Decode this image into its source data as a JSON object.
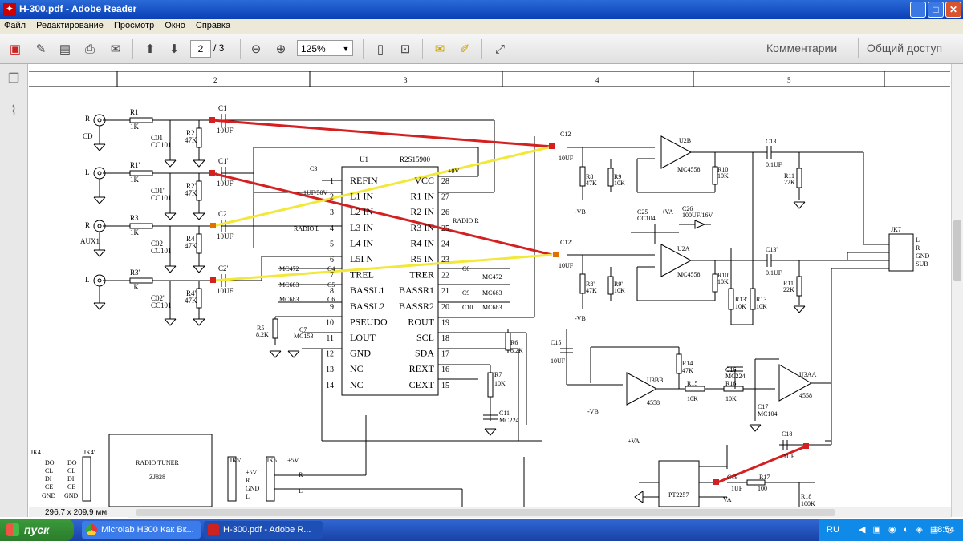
{
  "window": {
    "title": "H-300.pdf - Adobe Reader",
    "minimize": "_",
    "maximize": "□",
    "close": "✕"
  },
  "menu": [
    "Файл",
    "Редактирование",
    "Просмотр",
    "Окно",
    "Справка"
  ],
  "toolbar": {
    "page_current": "2",
    "page_total": "/ 3",
    "zoom": "125%",
    "comments": "Комментарии",
    "share": "Общий доступ"
  },
  "icons": [
    "create-pdf-icon",
    "edit-icon",
    "save-icon",
    "print-icon",
    "email-icon",
    "page-up-icon",
    "page-down-icon",
    "zoom-out-icon",
    "zoom-in-icon",
    "fit-page-icon",
    "fit-width-icon",
    "comment-icon",
    "highlight-icon",
    "fullscreen-icon",
    "pages-panel-icon",
    "attachments-icon"
  ],
  "status": {
    "page_size": "296,7 x 209,9 мм"
  },
  "schematic": {
    "columns": [
      "2",
      "3",
      "4",
      "5"
    ],
    "inputs": [
      {
        "jack": "R",
        "name": "CD",
        "r": "R1",
        "rv": "1K",
        "c": "C01",
        "cv": "CC101",
        "r2": "R2",
        "r2v": "47K",
        "cap": "C1",
        "capv": "10UF"
      },
      {
        "jack": "L",
        "name": "",
        "r": "R1'",
        "rv": "1K",
        "c": "C01'",
        "cv": "CC101",
        "r2": "R2'",
        "r2v": "47K",
        "cap": "C1'",
        "capv": "10UF"
      },
      {
        "jack": "R",
        "name": "AUX1",
        "r": "R3",
        "rv": "1K",
        "c": "C02",
        "cv": "CC101",
        "r2": "R4",
        "r2v": "47K",
        "cap": "C2",
        "capv": "10UF"
      },
      {
        "jack": "L",
        "name": "",
        "r": "R3'",
        "rv": "1K",
        "c": "C02'",
        "cv": "CC101",
        "r2": "R4'",
        "r2v": "47K",
        "cap": "C2'",
        "capv": "10UF"
      }
    ],
    "ic": {
      "ref": "U1",
      "part": "R2S15900",
      "left_pins": [
        [
          "REFIN",
          "1"
        ],
        [
          "L1 IN",
          "2"
        ],
        [
          "L2 IN",
          "3"
        ],
        [
          "L3 IN",
          "4"
        ],
        [
          "L4 IN",
          "5"
        ],
        [
          "L5I N",
          "6"
        ],
        [
          "TREL",
          "7"
        ],
        [
          "BASSL1",
          "8"
        ],
        [
          "BASSL2",
          "9"
        ],
        [
          "PSEUDO",
          "10"
        ],
        [
          "LOUT",
          "11"
        ],
        [
          "GND",
          "12"
        ],
        [
          "NC",
          "13"
        ],
        [
          "NC",
          "14"
        ]
      ],
      "right_pins": [
        [
          "VCC",
          "28"
        ],
        [
          "R1 IN",
          "27"
        ],
        [
          "R2 IN",
          "26"
        ],
        [
          "R3 IN",
          "25"
        ],
        [
          "R4 IN",
          "24"
        ],
        [
          "R5 IN",
          "23"
        ],
        [
          "TRER",
          "22"
        ],
        [
          "BASSR1",
          "21"
        ],
        [
          "BASSR2",
          "20"
        ],
        [
          "ROUT",
          "19"
        ],
        [
          "SCL",
          "18"
        ],
        [
          "SDA",
          "17"
        ],
        [
          "REXT",
          "16"
        ],
        [
          "CEXT",
          "15"
        ]
      ]
    },
    "labels": {
      "c3": "C3",
      "c3v": "1UF/50V",
      "vcc9": "+9V",
      "radio_l": "RADIO L",
      "radio_r": "RADIO R",
      "c4": "C4",
      "c4v": "MC472",
      "c5": "C5",
      "c5v": "MC683",
      "c6": "C6",
      "c6v": "MC683",
      "c7": "C7",
      "c7v": "MC153",
      "r5": "R5",
      "r5v": "8.2K",
      "c8": "C8",
      "c8v": "MC472",
      "c9": "C9",
      "c9v": "MC683",
      "c10": "C10",
      "c10v": "MC683",
      "r6": "R6",
      "r6v": "8.2K",
      "r7": "R7",
      "r7v": "10K",
      "c11": "C11",
      "c11v": "MC224",
      "c12": "C12",
      "c12v": "10UF",
      "c12b": "C12'",
      "c12bv": "10UF",
      "r8": "R8",
      "r8v": "47K",
      "r9": "R9",
      "r9v": "10K",
      "vb": "-VB",
      "r8b": "R8'",
      "r8bv": "47K",
      "r9b": "R9'",
      "r9bv": "10K",
      "u2b": "U2B",
      "u2a": "U2A",
      "mc4558": "MC4558",
      "r10": "R10",
      "r10v": "10K",
      "r10b": "R10'",
      "r10bv": "10K",
      "c13": "C13",
      "c13v": "0.1UF",
      "c13b": "C13'",
      "c13bv": "0.1UF",
      "r11": "R11",
      "r11v": "22K",
      "r11b": "R11'",
      "r11bv": "22K",
      "c25": "C25",
      "c25v": "CC104",
      "va": "+VA",
      "c26": "C26",
      "c26v": "100UF/16V",
      "r13b": "R13'",
      "r13bv": "10K",
      "r13": "R13",
      "r13v": "10K",
      "jk7": "JK7",
      "jk7_pins": [
        "L",
        "R",
        "GND",
        "SUB"
      ],
      "c15": "C15",
      "c15v": "10UF",
      "u3bb": "U3BB",
      "u3aa": "U3AA",
      "p4558": "4558",
      "r14": "R14",
      "r14v": "47K",
      "r15": "R15",
      "r15v": "10K",
      "r16": "R16",
      "r16v": "10K",
      "c16": "C16",
      "c16v": "MC224",
      "c17": "C17",
      "c17v": "MC104",
      "c18": "C18",
      "c18v": "1UF",
      "c19": "C19",
      "c19v": "1UF",
      "r17": "R17",
      "r17v": "100",
      "r18": "R18",
      "r18v": "100K",
      "pt2257": "PT2257",
      "vb2": "-VB",
      "va2": "+VA",
      "va3": "VA",
      "radio_tuner": "RADIO TUNER",
      "zj828": "ZJ828",
      "jk4": "JK4",
      "jk4b": "JK4'",
      "jk5": "JK5",
      "jk5b": "JK5'",
      "bus": [
        "DO",
        "CL",
        "DI",
        "CE",
        "GND"
      ],
      "jk5b_pins": [
        "+5V",
        "R",
        "GND",
        "L"
      ],
      "plus5v": "+5V",
      "r_lbl": "R",
      "l_lbl": "L"
    }
  },
  "taskbar": {
    "start": "пуск",
    "tasks": [
      "Microlab H300 Как Вк...",
      "H-300.pdf - Adobe R..."
    ],
    "lang": "RU",
    "clock": "18:54"
  }
}
